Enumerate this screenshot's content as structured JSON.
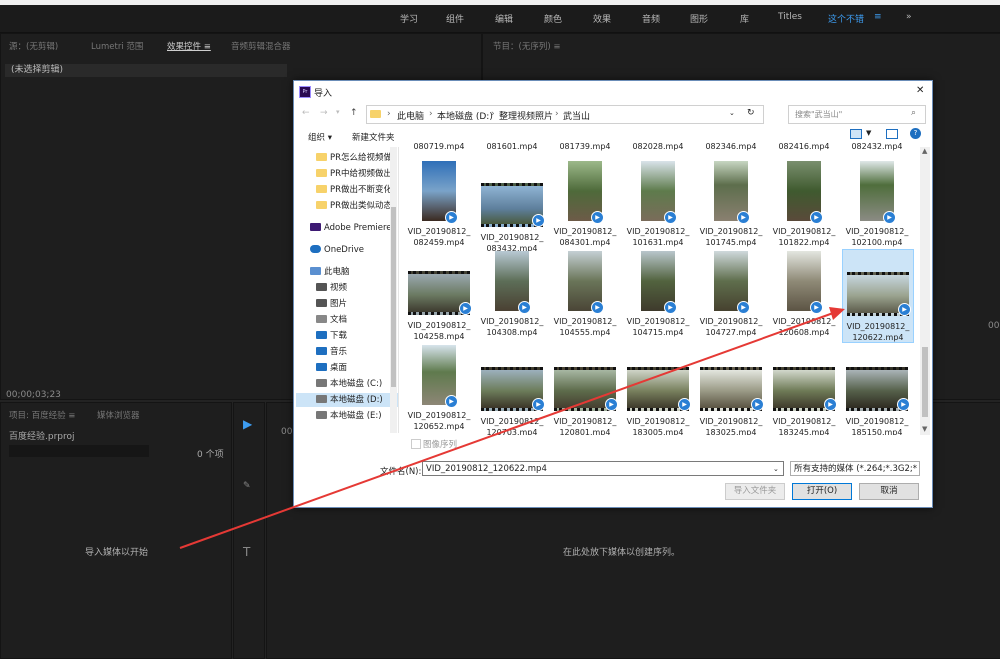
{
  "premiere": {
    "workspaces": [
      "学习",
      "组件",
      "编辑",
      "颜色",
      "效果",
      "音频",
      "图形",
      "库",
      "Titles",
      "这个不错"
    ],
    "active_workspace_suffix": "≡",
    "more_glyph": "»",
    "source_tabs": [
      "源：(无剪辑)",
      "Lumetri 范围",
      "效果控件 ≡",
      "音频剪辑混合器"
    ],
    "no_clip": "(未选择剪辑)",
    "program_tab": "节目：(无序列) ≡",
    "timecode": "00;00;03;23",
    "program_timecode": "00;",
    "timeline_time": "00:",
    "project_tabs": [
      "项目: 百度经验 ≡",
      "媒体浏览器"
    ],
    "project_file": "百度经验.prproj",
    "items_count": "0 个项",
    "import_hint": "导入媒体以开始",
    "timeline_hint": "在此处放下媒体以创建序列。"
  },
  "dialog": {
    "title": "导入",
    "close": "✕",
    "breadcrumb": [
      "此电脑",
      "本地磁盘 (D:)",
      "整理视频照片",
      "武当山"
    ],
    "search_placeholder": "搜索\"武当山\"",
    "organize": "组织 ▾",
    "new_folder": "新建文件夹",
    "nav": [
      "PR怎么给视频做",
      "PR中给视频做出",
      "PR做出不断变化",
      "PR做出类似动态",
      "Adobe Premiere",
      "OneDrive",
      "此电脑",
      "视频",
      "图片",
      "文档",
      "下载",
      "音乐",
      "桌面",
      "本地磁盘 (C:)",
      "本地磁盘 (D:)",
      "本地磁盘 (E:)"
    ],
    "top_partial": [
      "080719.mp4",
      "081601.mp4",
      "081739.mp4",
      "082028.mp4",
      "082346.mp4",
      "082416.mp4",
      "082432.mp4"
    ],
    "row1": [
      "VID_20190812_ 082459.mp4",
      "VID_20190812_ 083432.mp4",
      "VID_20190812_ 084301.mp4",
      "VID_20190812_ 101631.mp4",
      "VID_20190812_ 101745.mp4",
      "VID_20190812_ 101822.mp4",
      "VID_20190812_ 102100.mp4"
    ],
    "row2": [
      "VID_20190812_ 104258.mp4",
      "VID_20190812_ 104308.mp4",
      "VID_20190812_ 104555.mp4",
      "VID_20190812_ 104715.mp4",
      "VID_20190812_ 104727.mp4",
      "VID_20190812_ 120608.mp4",
      "VID_20190812_ 120622.mp4"
    ],
    "row3": [
      "VID_20190812_ 120652.mp4",
      "VID_20190812_ 120703.mp4",
      "VID_20190812_ 120801.mp4",
      "VID_20190812_ 183005.mp4",
      "VID_20190812_ 183025.mp4",
      "VID_20190812_ 183245.mp4",
      "VID_20190812_ 185150.mp4"
    ],
    "image_sequence": "图像序列",
    "filename_label": "文件名(N):",
    "filename_value": "VID_20190812_120622.mp4",
    "filetype_value": "所有支持的媒体 (*.264;*.3G2;*",
    "import_folder": "导入文件夹",
    "open": "打开(O)",
    "cancel": "取消"
  },
  "colors": {
    "accent": "#3d9cf0",
    "arrow": "#e53935",
    "selection": "#cce4f7"
  }
}
